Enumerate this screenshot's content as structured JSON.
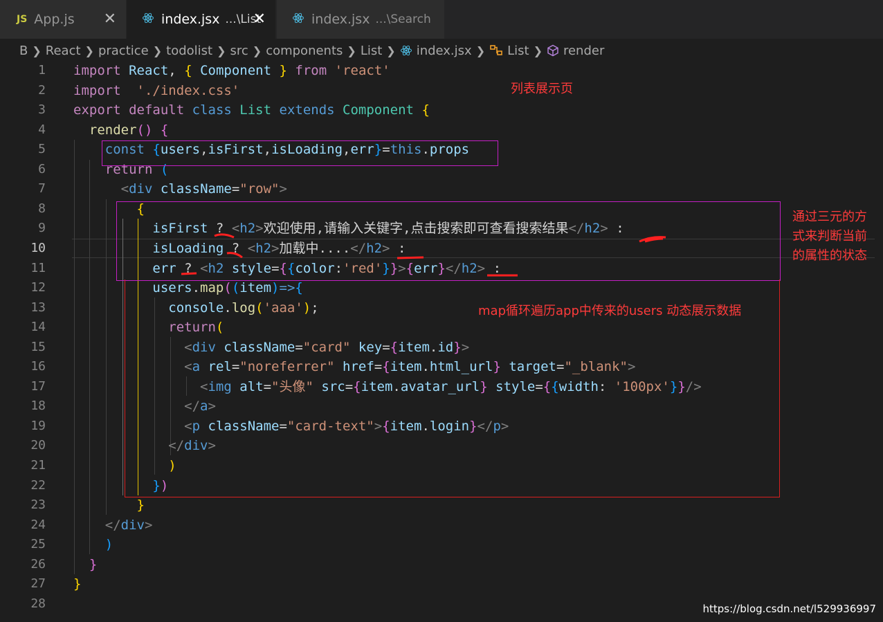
{
  "tabs": [
    {
      "icon": "js-file-icon",
      "badge": "JS",
      "name": "App.js",
      "desc": ""
    },
    {
      "icon": "react-icon",
      "name": "index.jsx",
      "desc": "...\\List",
      "active": true
    },
    {
      "icon": "react-icon",
      "name": "index.jsx",
      "desc": "...\\Search"
    }
  ],
  "breadcrumb": {
    "items": [
      "B",
      "React",
      "practice",
      "todolist",
      "src",
      "components",
      "List",
      "index.jsx",
      "List",
      "render"
    ]
  },
  "editor": {
    "current_line": 10,
    "lines": [
      {
        "n": "1",
        "html": "<span class='kc'>import</span> <span class='v'>React</span><span class='w'>, </span><span class='y'>{</span><span class='w'> </span><span class='v'>Component</span><span class='w'> </span><span class='y'>}</span><span class='w'> </span><span class='kc'>from</span><span class='w'> </span><span class='s'>'react'</span>"
      },
      {
        "n": "2",
        "html": "<span class='kc'>import</span><span class='w'>  </span><span class='s'>'./index.css'</span>"
      },
      {
        "n": "3",
        "html": "<span class='kc'>export</span> <span class='kc'>default</span> <span class='k'>class</span> <span class='c'>List</span> <span class='k'>extends</span> <span class='c'>Component</span> <span class='y'>{</span>"
      },
      {
        "n": "4",
        "html": "  <span class='f'>render</span><span class='p'>()</span> <span class='p'>{</span>"
      },
      {
        "n": "5",
        "html": "    <span class='k'>const</span> <span class='b'>{</span><span class='v'>users</span><span class='w'>,</span><span class='v'>isFirst</span><span class='w'>,</span><span class='v'>isLoading</span><span class='w'>,</span><span class='v'>err</span><span class='b'>}</span><span class='w'>=</span><span class='k'>this</span><span class='w'>.</span><span class='v'>props</span>"
      },
      {
        "n": "6",
        "html": "    <span class='kc'>return</span> <span class='b'>(</span>"
      },
      {
        "n": "7",
        "html": "      <span class='t'>&lt;</span><span class='tg'>div</span> <span class='at'>className</span><span class='w'>=</span><span class='s'>\"row\"</span><span class='t'>&gt;</span>"
      },
      {
        "n": "8",
        "html": "        <span class='y'>{</span>"
      },
      {
        "n": "9",
        "html": "          <span class='v'>isFirst</span> <span class='w'>?</span> <span class='t'>&lt;</span><span class='tg'>h2</span><span class='t'>&gt;</span><span class='w'>欢迎使用,请输入关键字,点击搜索即可查看搜索结果</span><span class='t'>&lt;/</span><span class='tg'>h2</span><span class='t'>&gt;</span> <span class='w'>:</span>"
      },
      {
        "n": "10",
        "html": "          <span class='v'>isLoading</span> <span class='w'>?</span> <span class='t'>&lt;</span><span class='tg'>h2</span><span class='t'>&gt;</span><span class='w'>加载中....</span><span class='t'>&lt;/</span><span class='tg'>h2</span><span class='t'>&gt;</span> <span class='w'>:</span>"
      },
      {
        "n": "11",
        "html": "          <span class='v'>err</span> <span class='w'>?</span> <span class='t'>&lt;</span><span class='tg'>h2</span> <span class='at'>style</span><span class='w'>=</span><span class='p'>{</span><span class='b'>{</span><span class='v'>color</span><span class='w'>:</span><span class='s'>'red'</span><span class='b'>}</span><span class='p'>}</span><span class='t'>&gt;</span><span class='p'>{</span><span class='v'>err</span><span class='p'>}</span><span class='t'>&lt;/</span><span class='tg'>h2</span><span class='t'>&gt;</span> <span class='w'>:</span>"
      },
      {
        "n": "12",
        "html": "          <span class='v'>users</span><span class='w'>.</span><span class='f'>map</span><span class='p'>(</span><span class='b'>(</span><span class='v'>item</span><span class='b'>)</span><span class='k'>=&gt;</span><span class='b'>{</span>"
      },
      {
        "n": "13",
        "html": "            <span class='v'>console</span><span class='w'>.</span><span class='f'>log</span><span class='y'>(</span><span class='s'>'aaa'</span><span class='y'>)</span><span class='w'>;</span>"
      },
      {
        "n": "14",
        "html": "            <span class='kc'>return</span><span class='y'>(</span>"
      },
      {
        "n": "15",
        "html": "              <span class='t'>&lt;</span><span class='tg'>div</span> <span class='at'>className</span><span class='w'>=</span><span class='s'>\"card\"</span> <span class='at'>key</span><span class='w'>=</span><span class='p'>{</span><span class='v'>item</span><span class='w'>.</span><span class='v'>id</span><span class='p'>}</span><span class='t'>&gt;</span>"
      },
      {
        "n": "16",
        "html": "              <span class='t'>&lt;</span><span class='tg'>a</span> <span class='at'>rel</span><span class='w'>=</span><span class='s'>\"noreferrer\"</span> <span class='at'>href</span><span class='w'>=</span><span class='p'>{</span><span class='v'>item</span><span class='w'>.</span><span class='v'>html_url</span><span class='p'>}</span> <span class='at'>target</span><span class='w'>=</span><span class='s'>\"_blank\"</span><span class='t'>&gt;</span>"
      },
      {
        "n": "17",
        "html": "                <span class='t'>&lt;</span><span class='tg'>img</span> <span class='at'>alt</span><span class='w'>=</span><span class='s'>\"头像\"</span> <span class='at'>src</span><span class='w'>=</span><span class='p'>{</span><span class='v'>item</span><span class='w'>.</span><span class='v'>avatar_url</span><span class='p'>}</span> <span class='at'>style</span><span class='w'>=</span><span class='p'>{</span><span class='b'>{</span><span class='v'>width</span><span class='w'>: </span><span class='s'>'100px'</span><span class='b'>}</span><span class='p'>}</span><span class='t'>/&gt;</span>"
      },
      {
        "n": "18",
        "html": "              <span class='t'>&lt;/</span><span class='tg'>a</span><span class='t'>&gt;</span>"
      },
      {
        "n": "19",
        "html": "              <span class='t'>&lt;</span><span class='tg'>p</span> <span class='at'>className</span><span class='w'>=</span><span class='s'>\"card-text\"</span><span class='t'>&gt;</span><span class='p'>{</span><span class='v'>item</span><span class='w'>.</span><span class='v'>login</span><span class='p'>}</span><span class='t'>&lt;/</span><span class='tg'>p</span><span class='t'>&gt;</span>"
      },
      {
        "n": "20",
        "html": "            <span class='t'>&lt;/</span><span class='tg'>div</span><span class='t'>&gt;</span>"
      },
      {
        "n": "21",
        "html": "            <span class='y'>)</span>"
      },
      {
        "n": "22",
        "html": "          <span class='b'>}</span><span class='p'>)</span>"
      },
      {
        "n": "23",
        "html": "        <span class='y'>}</span>"
      },
      {
        "n": "24",
        "html": "    <span class='t'>&lt;/</span><span class='tg'>div</span><span class='t'>&gt;</span>"
      },
      {
        "n": "25",
        "html": "    <span class='b'>)</span>"
      },
      {
        "n": "26",
        "html": "  <span class='p'>}</span>"
      },
      {
        "n": "27",
        "html": "<span class='y'>}</span>"
      },
      {
        "n": "28",
        "html": ""
      }
    ]
  },
  "annotations": {
    "list_page": "列表展示页",
    "ternary_note_1": "通过三元的方",
    "ternary_note_2": "式来判断当前",
    "ternary_note_3": "的属性的状态",
    "map_note": "map循环遍历app中传来的users  动态展示数据"
  },
  "watermark": "https://blog.csdn.net/l529936997"
}
